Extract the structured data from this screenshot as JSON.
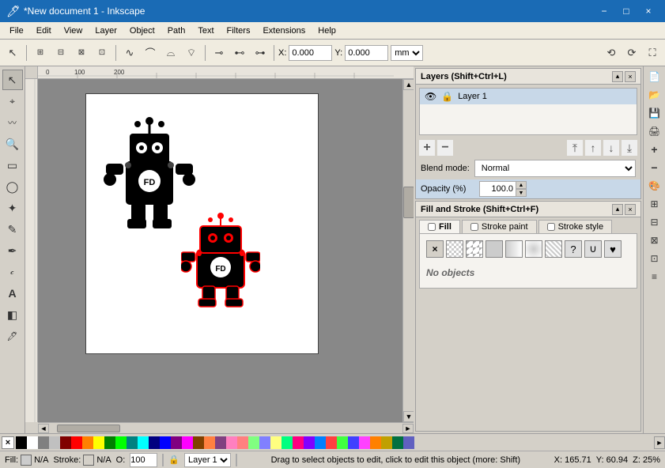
{
  "titleBar": {
    "title": "*New document 1 - Inkscape",
    "minBtn": "−",
    "maxBtn": "□",
    "closeBtn": "×"
  },
  "menuBar": {
    "items": [
      "File",
      "Edit",
      "View",
      "Layer",
      "Object",
      "Path",
      "Text",
      "Filters",
      "Extensions",
      "Help"
    ]
  },
  "toolbar": {
    "coordX": {
      "label": "X:",
      "value": "0.000"
    },
    "coordY": {
      "label": "Y:",
      "value": "0.000"
    },
    "unit": "mm"
  },
  "leftTools": {
    "tools": [
      {
        "name": "select",
        "icon": "↖",
        "active": true
      },
      {
        "name": "node-edit",
        "icon": "⌖"
      },
      {
        "name": "tweak",
        "icon": "⌀"
      },
      {
        "name": "zoom",
        "icon": "🔍"
      },
      {
        "name": "rect",
        "icon": "▭"
      },
      {
        "name": "circle",
        "icon": "◯"
      },
      {
        "name": "star",
        "icon": "✦"
      },
      {
        "name": "pencil",
        "icon": "✏"
      },
      {
        "name": "pen",
        "icon": "✒"
      },
      {
        "name": "text",
        "icon": "A"
      },
      {
        "name": "gradient",
        "icon": "◧"
      },
      {
        "name": "eyedropper",
        "icon": "💧"
      }
    ]
  },
  "layersPanel": {
    "title": "Layers (Shift+Ctrl+L)",
    "layer": {
      "name": "Layer 1"
    },
    "blendLabel": "Blend mode:",
    "blendValue": "Normal",
    "opacityLabel": "Opacity (%)",
    "opacityValue": "100.0",
    "addBtn": "+",
    "removeBtn": "−"
  },
  "fillPanel": {
    "title": "Fill and Stroke (Shift+Ctrl+F)",
    "tabs": [
      "Fill",
      "Stroke paint",
      "Stroke style"
    ],
    "noObjects": "No objects"
  },
  "statusBar": {
    "fillLabel": "Fill:",
    "fillValue": "N/A",
    "strokeLabel": "Stroke:",
    "strokeValue": "N/A",
    "opacityLabel": "O:",
    "opacityValue": "100",
    "layerValue": "Layer 1",
    "message": "Drag to select objects to edit, click to edit this object (more: Shift)",
    "coordX": "X: 165.71",
    "coordY": "Y: 60.94",
    "zoom": "Z: 25%"
  },
  "palette": {
    "colors": [
      "#000000",
      "#ffffff",
      "#808080",
      "#c0c0c0",
      "#800000",
      "#ff0000",
      "#ff8000",
      "#ffff00",
      "#008000",
      "#00ff00",
      "#008080",
      "#00ffff",
      "#000080",
      "#0000ff",
      "#800080",
      "#ff00ff",
      "#804000",
      "#ff8040",
      "#804080",
      "#ff80c0",
      "#ff8080",
      "#80ff80",
      "#8080ff",
      "#ffff80",
      "#00ff80",
      "#ff0080",
      "#8000ff",
      "#0080ff",
      "#ff4040",
      "#40ff40",
      "#4040ff",
      "#ff40ff",
      "#ff8000",
      "#c0a000",
      "#007040",
      "#6060c0"
    ]
  }
}
